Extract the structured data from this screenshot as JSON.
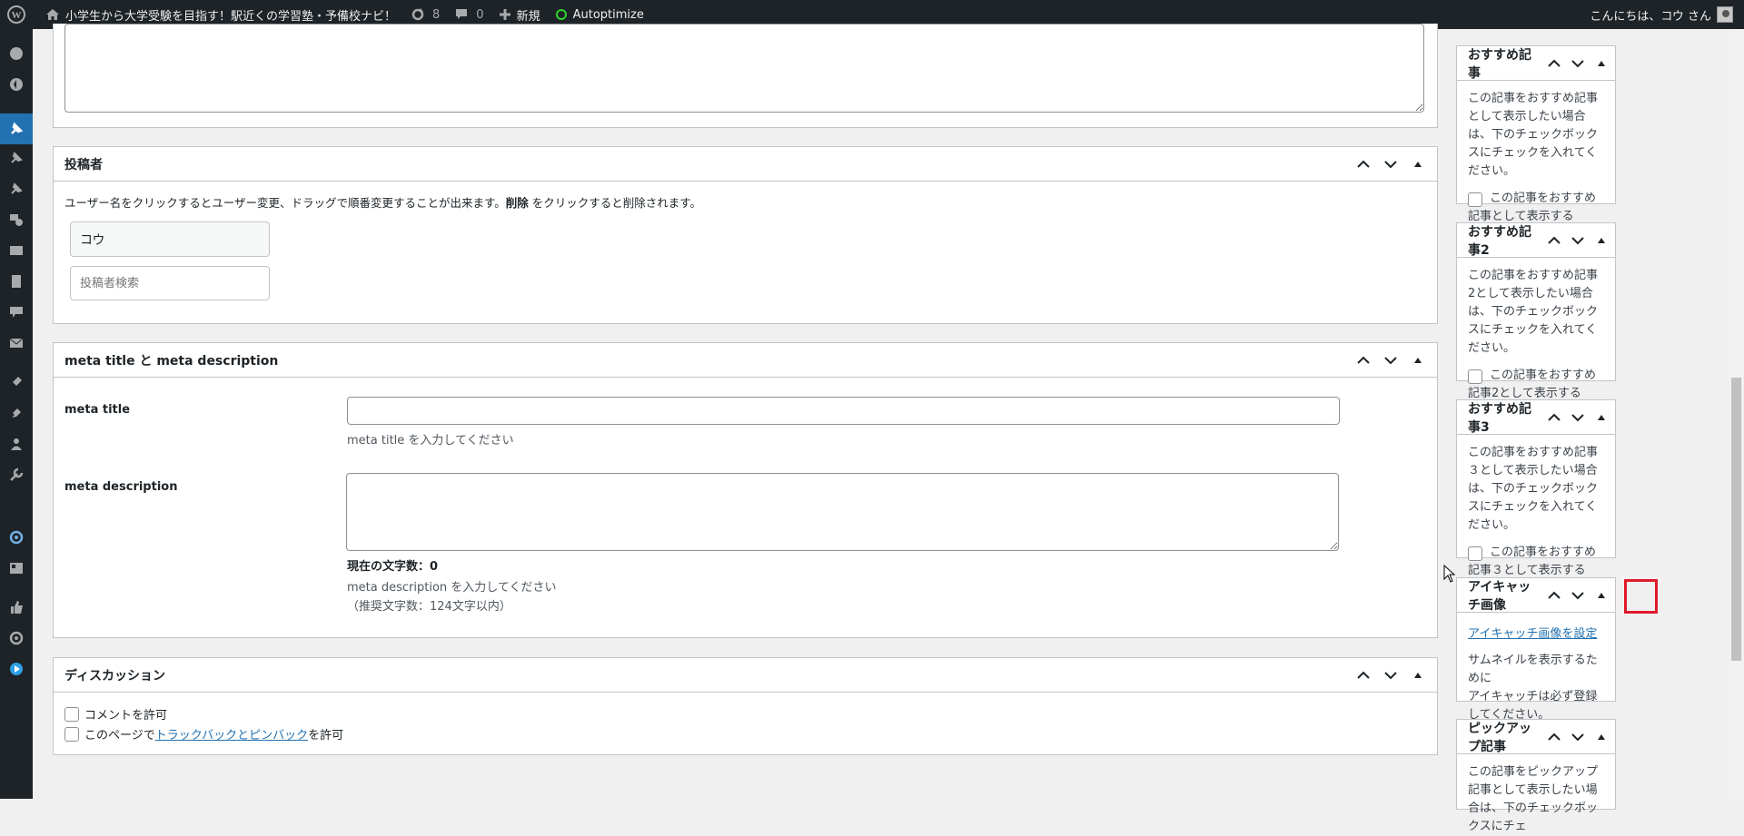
{
  "adminbar": {
    "site_name": "小学生から大学受験を目指す！駅近くの学習塾・予備校ナビ！",
    "updates_count": "8",
    "comments_count": "0",
    "new_label": "新規",
    "autoptimize_label": "Autoptimize",
    "greeting": "こんにちは、コウ さん"
  },
  "main": {
    "author_box": {
      "title": "投稿者",
      "help": "ユーザー名をクリックするとユーザー変更、ドラッグで順番変更することが出来ます。",
      "help_bold": "削除",
      "help_tail": " をクリックすると削除されます。",
      "author_name": "コウ",
      "search_placeholder": "投稿者検索"
    },
    "meta_box": {
      "title": "meta title と meta description",
      "meta_title_label": "meta title",
      "meta_title_help": "meta title を入力してください",
      "meta_desc_label": "meta description",
      "char_count": "現在の文字数：0",
      "meta_desc_help": "meta description を入力してください",
      "meta_desc_recommend": "（推奨文字数：124文字以内）"
    },
    "discussion_box": {
      "title": "ディスカッション",
      "allow_comments": "コメントを許可",
      "trackback_prefix": "このページで",
      "trackback_link": "トラックバックとピンバック",
      "trackback_suffix": "を許可"
    }
  },
  "sidebar": {
    "recommended1": {
      "title": "おすすめ記事",
      "text": "この記事をおすすめ記事として表示したい場合は、下のチェックボックスにチェックを入れてください。",
      "checkbox": "この記事をおすすめ記事として表示する"
    },
    "recommended2": {
      "title": "おすすめ記事2",
      "text": "この記事をおすすめ記事2として表示したい場合は、下のチェックボックスにチェックを入れてください。",
      "checkbox": "この記事をおすすめ記事2として表示する"
    },
    "recommended3": {
      "title": "おすすめ記事3",
      "text": "この記事をおすすめ記事３として表示したい場合は、下のチェックボックスにチェックを入れてください。",
      "checkbox": "この記事をおすすめ記事３として表示する"
    },
    "featured_image": {
      "title": "アイキャッチ画像",
      "link": "アイキャッチ画像を設定",
      "note1": "サムネイルを表示するために",
      "note2": "アイキャッチは必ず登録してください。"
    },
    "pickup": {
      "title": "ピックアップ記事",
      "text": "この記事をピックアップ記事として表示したい場合は、下のチェックボックスにチェ"
    }
  },
  "colors": {
    "adminbar_bg": "#1d2327",
    "accent": "#2271b1",
    "highlight": "#e01a2b"
  }
}
